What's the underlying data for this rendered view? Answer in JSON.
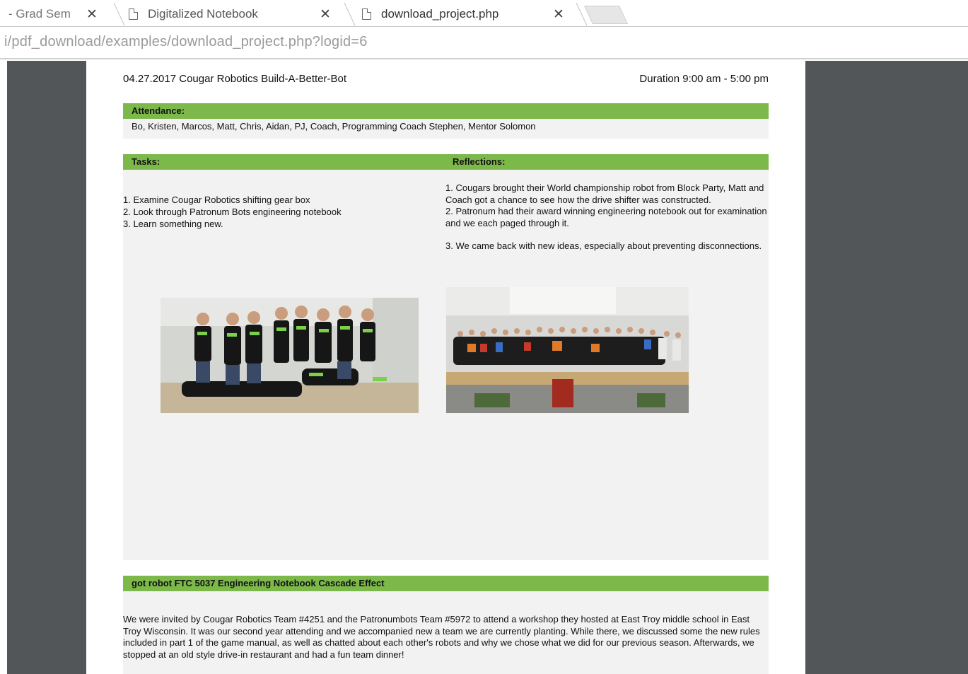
{
  "browser": {
    "tabs": [
      {
        "label": "- Grad Sem",
        "active": false
      },
      {
        "label": "Digitalized Notebook",
        "active": false
      },
      {
        "label": "download_project.php",
        "active": true
      }
    ],
    "close_glyph": "✕",
    "address": "i/pdf_download/examples/download_project.php?logid=6"
  },
  "pdf": {
    "header": {
      "title": "04.27.2017 Cougar Robotics Build-A-Better-Bot",
      "duration": "Duration 9:00 am - 5:00 pm"
    },
    "attendance": {
      "label": "Attendance:",
      "text": "Bo, Kristen, Marcos, Matt, Chris, Aidan, PJ, Coach, Programming Coach Stephen, Mentor Solomon"
    },
    "tasks": {
      "label": "Tasks:",
      "items": [
        "1. Examine Cougar Robotics shifting gear box",
        "2. Look through Patronum Bots engineering notebook",
        "3. Learn something new."
      ]
    },
    "reflections": {
      "label": "Reflections:",
      "paragraphs": [
        "1. Cougars brought their World championship robot from Block Party, Matt and Coach got a chance to see how the drive shifter was constructed.",
        "2. Patronum had their award winning engineering notebook out for examination and we each paged through it.",
        "3. We came back with new ideas, especially about preventing disconnections."
      ]
    },
    "section": {
      "label": "got robot FTC 5037 Engineering Notebook Cascade Effect",
      "text": "We were invited by Cougar Robotics Team #4251 and the Patronumbots Team #5972 to attend a workshop they hosted at East Troy middle school in East Troy Wisconsin. It was our second year attending and we accompanied new a team we are currently planting. While there, we discussed some the new rules included in part 1 of the game manual, as well as chatted about each other's robots and why we chose what we did for our previous season. Afterwards, we stopped at an old style drive-in restaurant and had a fun team dinner!"
    }
  },
  "colors": {
    "accent_green": "#7cb84a",
    "viewer_bg": "#525659",
    "box_grey": "#f2f2f2"
  }
}
